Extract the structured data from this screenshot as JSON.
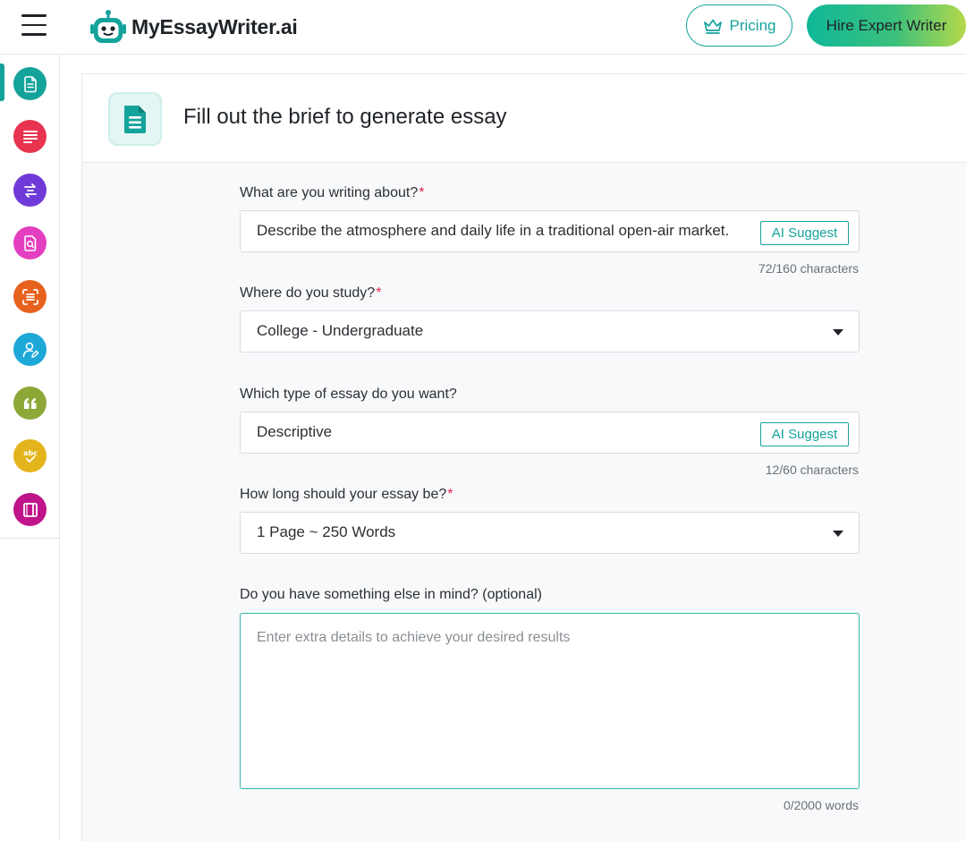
{
  "header": {
    "brand": "MyEssayWriter.ai",
    "pricing_label": "Pricing",
    "hire_label": "Hire Expert Writer",
    "colors": {
      "accent": "#14a39b",
      "hire_gradient_start": "#0fb89a",
      "hire_gradient_end": "#b6d94a"
    }
  },
  "sidebar": {
    "items": [
      {
        "name": "essay-writer",
        "icon": "document-icon",
        "color": "#14a39b",
        "active": true
      },
      {
        "name": "paragraph-writer",
        "icon": "text-lines-icon",
        "color": "#e8344f",
        "active": false
      },
      {
        "name": "rephraser",
        "icon": "swap-lines-icon",
        "color": "#6f3bd8",
        "active": false
      },
      {
        "name": "plagiarism-checker",
        "icon": "document-search-icon",
        "color": "#e43fc0",
        "active": false
      },
      {
        "name": "summarizer",
        "icon": "scan-text-icon",
        "color": "#e8621f",
        "active": false
      },
      {
        "name": "humanizer",
        "icon": "user-edit-icon",
        "color": "#1ea8d8",
        "active": false
      },
      {
        "name": "citation-generator",
        "icon": "quote-icon",
        "color": "#8ea838",
        "active": false
      },
      {
        "name": "grammar-checker",
        "icon": "abc-check-icon",
        "color": "#e4b41d",
        "active": false
      },
      {
        "name": "book-tool",
        "icon": "book-icon",
        "color": "#c0148a",
        "active": false
      }
    ]
  },
  "panel": {
    "title": "Fill out the brief to generate essay"
  },
  "form": {
    "topic": {
      "label": "What are you writing about?",
      "required_mark": "*",
      "value": "Describe the atmosphere and daily life in a traditional open-air market.",
      "ai_label": "AI Suggest",
      "counter": "72/160 characters"
    },
    "study": {
      "label": "Where do you study?",
      "required_mark": "*",
      "value": "College - Undergraduate"
    },
    "essay_type": {
      "label": "Which type of essay do you want?",
      "value": "Descriptive",
      "ai_label": "AI Suggest",
      "counter": "12/60 characters"
    },
    "length": {
      "label": "How long should your essay be?",
      "required_mark": "*",
      "value": "1 Page ~ 250 Words"
    },
    "extra": {
      "label": "Do you have something else in mind? (optional)",
      "placeholder": "Enter extra details to achieve your desired results",
      "counter": "0/2000 words"
    }
  }
}
